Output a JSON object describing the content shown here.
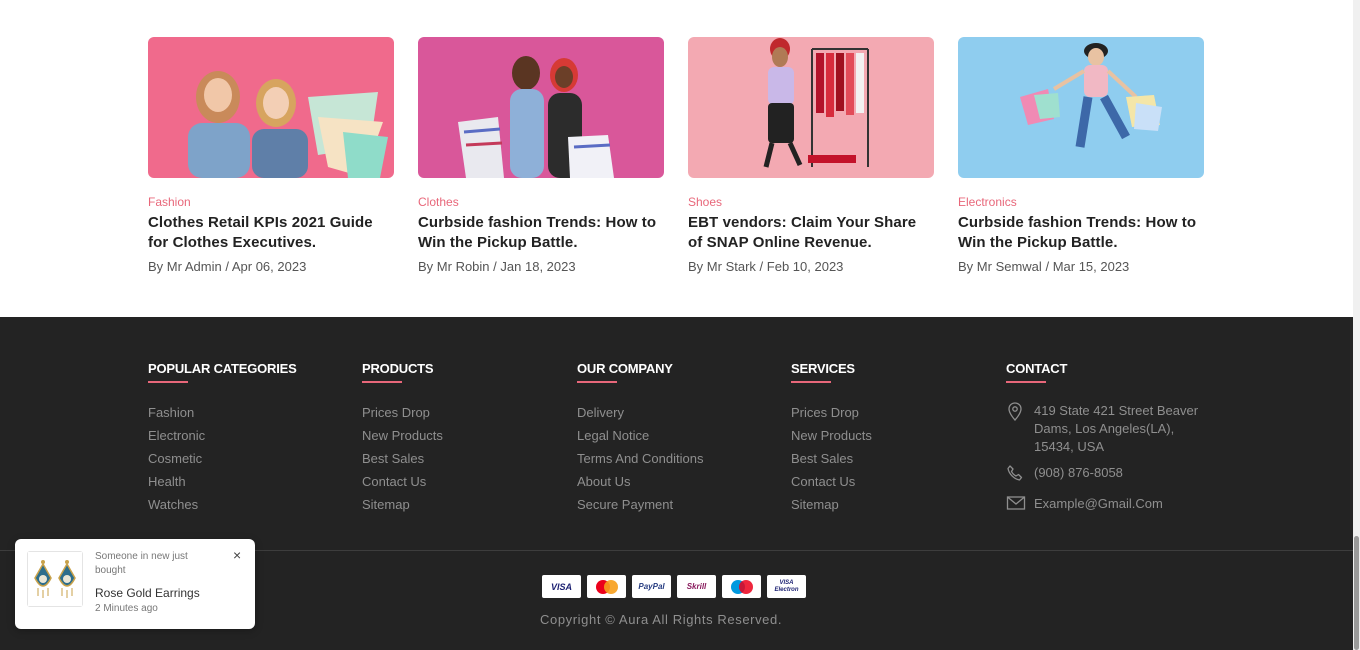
{
  "blog": {
    "posts": [
      {
        "category": "Fashion",
        "title": "Clothes Retail KPIs 2021 Guide for Clothes Executives.",
        "by": "By",
        "author": "Mr Admin",
        "sep": "/",
        "date": "Apr 06, 2023",
        "bg": "#f06a8c"
      },
      {
        "category": "Clothes",
        "title": "Curbside fashion Trends: How to Win the Pickup Battle.",
        "by": "By",
        "author": "Mr Robin",
        "sep": "/",
        "date": "Jan 18, 2023",
        "bg": "#d9579a"
      },
      {
        "category": "Shoes",
        "title": "EBT vendors: Claim Your Share of SNAP Online Revenue.",
        "by": "By",
        "author": "Mr Stark",
        "sep": "/",
        "date": "Feb 10, 2023",
        "bg": "#f3a9b2"
      },
      {
        "category": "Electronics",
        "title": "Curbside fashion Trends: How to Win the Pickup Battle.",
        "by": "By",
        "author": "Mr Semwal",
        "sep": "/",
        "date": "Mar 15, 2023",
        "bg": "#8fcdef"
      }
    ]
  },
  "footer": {
    "popular": {
      "heading": "POPULAR CATEGORIES",
      "items": [
        "Fashion",
        "Electronic",
        "Cosmetic",
        "Health",
        "Watches"
      ]
    },
    "products": {
      "heading": "PRODUCTS",
      "items": [
        "Prices Drop",
        "New Products",
        "Best Sales",
        "Contact Us",
        "Sitemap"
      ]
    },
    "company": {
      "heading": "OUR COMPANY",
      "items": [
        "Delivery",
        "Legal Notice",
        "Terms And Conditions",
        "About Us",
        "Secure Payment"
      ]
    },
    "services": {
      "heading": "SERVICES",
      "items": [
        "Prices Drop",
        "New Products",
        "Best Sales",
        "Contact Us",
        "Sitemap"
      ]
    },
    "contact": {
      "heading": "CONTACT",
      "address": "419 State 421 Street Beaver Dams, Los Angeles(LA), 15434, USA",
      "phone": "(908) 876-8058",
      "email": "Example@Gmail.Com"
    },
    "payments": [
      "VISA",
      "MasterCard",
      "PayPal",
      "Skrill",
      "Maestro",
      "VISA Electron"
    ],
    "copyright": "Copyright © Aura All Rights Reserved."
  },
  "toast": {
    "subtitle": "Someone in new just bought",
    "product": "Rose Gold Earrings",
    "time": "2 Minutes ago",
    "close": "×"
  },
  "colors": {
    "accent": "#e8677a",
    "footer_bg": "#232323"
  }
}
